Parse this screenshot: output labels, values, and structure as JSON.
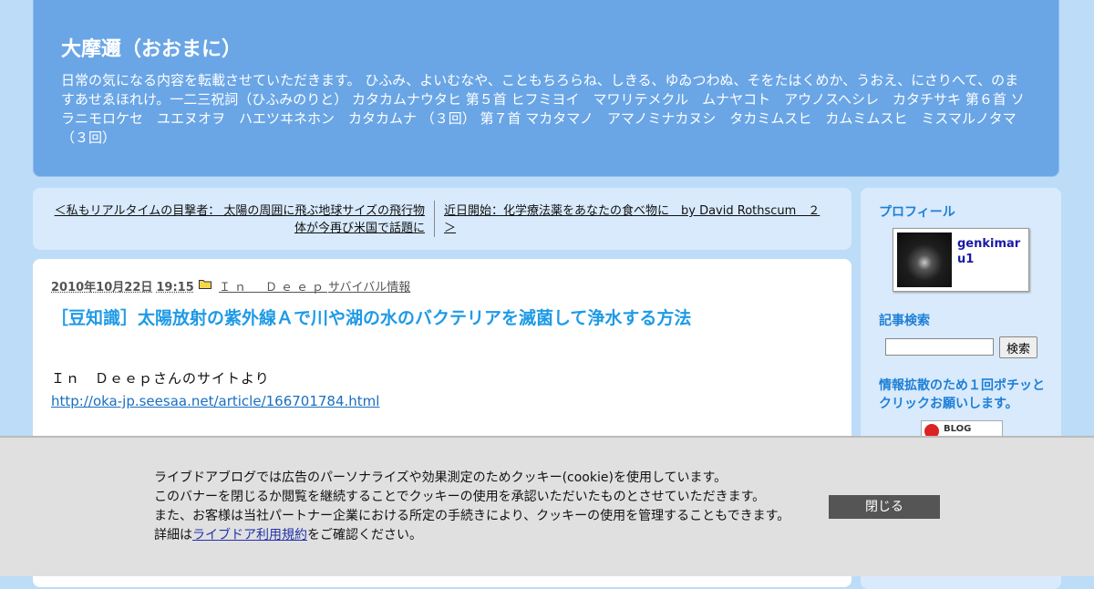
{
  "header": {
    "title": "大摩邇（おおまに）",
    "description": "日常の気になる内容を転載させていただきます。 ひふみ、よいむなや、こともちろらね、しきる、ゆゐつわぬ、そをたはくめか、うおえ、にさりへて、のますあせゑほれけ。一二三祝詞（ひふみのりと） カタカムナウタヒ 第５首 ヒフミヨイ　マワリテメクル　ムナヤコト　アウノスヘシレ　カタチサキ 第６首 ソラニモロケセ　ユエヌオヲ　ハエツヰネホン　カタカムナ （３回） 第７首 マカタマノ　アマノミナカヌシ　タカミムスヒ　カムミムスヒ　ミスマルノタマ （３回）"
  },
  "nav": {
    "prev": "＜私もリアルタイムの目撃者： 太陽の周囲に飛ぶ地球サイズの飛行物体が今再び米国で話題に",
    "next": "近日開始：化学療法薬をあなたの食べ物に　by David Rothscum　２＞"
  },
  "post": {
    "date": "2010年10月22日",
    "time": "19:15",
    "category1": "Ｉｎ　Ｄｅｅｐ",
    "category2": "サバイバル情報",
    "title": "［豆知識］太陽放射の紫外線Ａで川や湖の水のバクテリアを滅菌して浄水する方法",
    "body_line1": "Ｉｎ　Ｄｅｅｐさんのサイトより",
    "link": "http://oka-jp.seesaa.net/article/166701784.html"
  },
  "sidebar": {
    "profile_heading": "プロフィール",
    "profile_name": "genkimaru1",
    "search_heading": "記事検索",
    "search_button": "検索",
    "search_value": "",
    "ranking_heading": "情報拡散のため１回ポチッとクリックお願いします。",
    "ranking_badge": "BLOG"
  },
  "cookie": {
    "line1": "ライブドアブログでは広告のパーソナライズや効果測定のためクッキー(cookie)を使用しています。",
    "line2": "このバナーを閉じるか閲覧を継続することでクッキーの使用を承認いただいたものとさせていただきます。",
    "line3": "また、お客様は当社パートナー企業における所定の手続きにより、クッキーの使用を管理することもできます。",
    "line4_prefix": "詳細は",
    "line4_link": "ライブドア利用規約",
    "line4_suffix": "をご確認ください。",
    "close_button": "閉じる"
  }
}
